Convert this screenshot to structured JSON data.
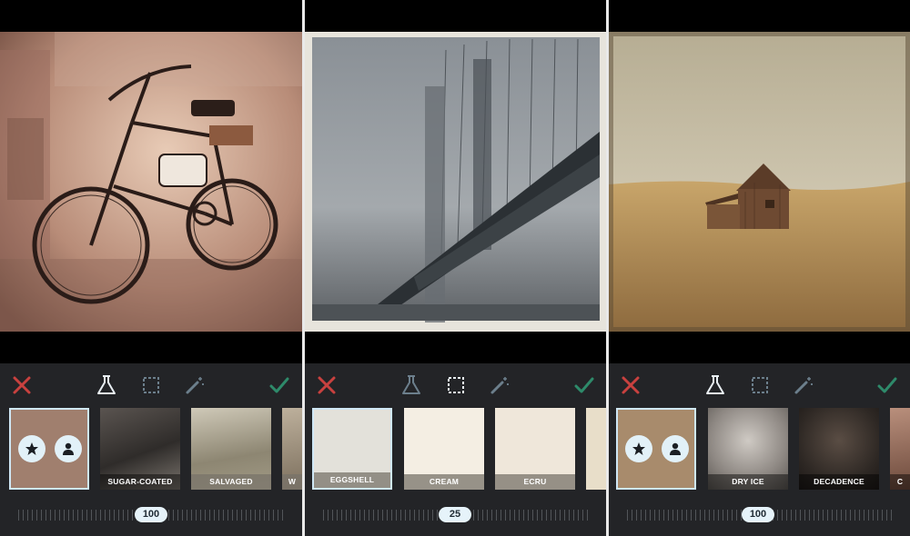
{
  "screens": [
    {
      "active_tool": "textures",
      "presets": [
        "SUGAR-COATED",
        "SALVAGED",
        "W"
      ],
      "slider_value": "100"
    },
    {
      "active_tool": "frames",
      "presets": [
        "EGGSHELL",
        "CREAM",
        "ECRU"
      ],
      "slider_value": "25"
    },
    {
      "active_tool": "textures",
      "presets": [
        "DRY ICE",
        "DECADENCE",
        "C"
      ],
      "slider_value": "100"
    }
  ],
  "icons": {
    "cancel": "close-icon",
    "textures": "flask-icon",
    "frames": "frame-icon",
    "adjust": "magic-wand-icon",
    "confirm": "checkmark-icon",
    "favorites": "star-icon",
    "custom": "person-icon"
  },
  "colors": {
    "toolbar_bg": "#232427",
    "cancel_red": "#c9413f",
    "confirm_green": "#2e8a6a",
    "active_icon": "#e8eef2",
    "inactive_icon": "#6c7f8c",
    "selection": "#cfe7f5"
  }
}
